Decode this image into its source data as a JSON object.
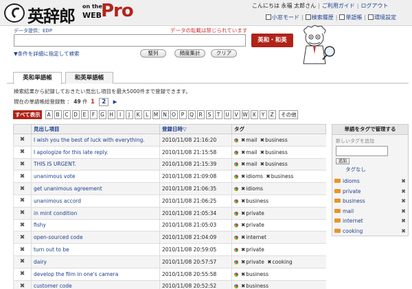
{
  "header": {
    "logo_title": "英辞郎",
    "logo_onthe": "on the",
    "logo_web": "WEB",
    "logo_pro": "Pro",
    "greeting": "こんにちは 永福 太郎さん",
    "guide_link": "ご利用ガイド",
    "logout_link": "ログアウト",
    "nav": [
      "小窓モード",
      "検索履歴",
      "単語帳",
      "環境設定"
    ]
  },
  "search": {
    "provider": "データ提供：EDP",
    "notice": "データの転載は禁じられています",
    "input_value": "",
    "submit_label": "英和・和英",
    "detail_link": "▼条件を詳細に指定して検索",
    "sort_label": "整列",
    "freq_label": "頻度集計",
    "clear_label": "クリア"
  },
  "tabs": [
    "英和単語帳",
    "和英単語帳"
  ],
  "description": "検索結果から記録しておきたい見出し項目を最大5000件まで登録できます。",
  "count": {
    "prefix": "現在の単語帳総登録数 ：",
    "total": "49",
    "unit": "件",
    "pages": [
      "1",
      "2"
    ],
    "next": "▶"
  },
  "letters": {
    "all_label": "すべて表示",
    "items": [
      "A",
      "B",
      "C",
      "D",
      "E",
      "F",
      "G",
      "H",
      "I",
      "J",
      "K",
      "L",
      "M",
      "N",
      "O",
      "P",
      "Q",
      "R",
      "S",
      "T",
      "U",
      "V",
      "W",
      "X",
      "Y",
      "Z"
    ],
    "other_label": "その他"
  },
  "table": {
    "headers": {
      "word": "見出し項目",
      "date": "登録日時▽",
      "tags": "タグ"
    },
    "delete_glyph": "✖",
    "tag_delete_glyph": "✖",
    "rows": [
      {
        "word": "I wish you the best of luck with everything.",
        "date": "2010/11/08 21:16:20",
        "tags": [
          "mail",
          "business"
        ]
      },
      {
        "word": "I apologize for this late reply.",
        "date": "2010/11/08 21:15:58",
        "tags": [
          "mail",
          "business"
        ]
      },
      {
        "word": "THIS IS URGENT.",
        "date": "2010/11/08 21:15:39",
        "tags": [
          "mail",
          "business"
        ]
      },
      {
        "word": "unanimous vote",
        "date": "2010/11/08 21:09:08",
        "tags": [
          "idioms",
          "business"
        ]
      },
      {
        "word": "get unanimous agreement",
        "date": "2010/11/08 21:06:35",
        "tags": [
          "idioms"
        ]
      },
      {
        "word": "unanimous accord",
        "date": "2010/11/08 21:06:25",
        "tags": [
          "business"
        ]
      },
      {
        "word": "in mint condition",
        "date": "2010/11/08 21:05:34",
        "tags": [
          "private"
        ]
      },
      {
        "word": "fishy",
        "date": "2010/11/08 21:05:03",
        "tags": [
          "private"
        ]
      },
      {
        "word": "open-sourced code",
        "date": "2010/11/08 21:04:09",
        "tags": [
          "internet"
        ]
      },
      {
        "word": "turn out to be",
        "date": "2010/11/08 20:59:05",
        "tags": [
          "private"
        ]
      },
      {
        "word": "dairy",
        "date": "2010/11/08 20:57:57",
        "tags": [
          "private",
          "cooking"
        ]
      },
      {
        "word": "develop the film in one's camera",
        "date": "2010/11/08 20:55:58",
        "tags": [
          "business"
        ]
      },
      {
        "word": "customer code",
        "date": "2010/11/08 20:52:52",
        "tags": [
          "business"
        ]
      }
    ]
  },
  "side": {
    "title": "単語をタグで管理する",
    "placeholder": "新しいタグを追加",
    "add_label": "追加",
    "no_tag": "タグなし",
    "tags": [
      "idioms",
      "private",
      "business",
      "mail",
      "internet",
      "cooking"
    ],
    "delete_glyph": "✖"
  }
}
